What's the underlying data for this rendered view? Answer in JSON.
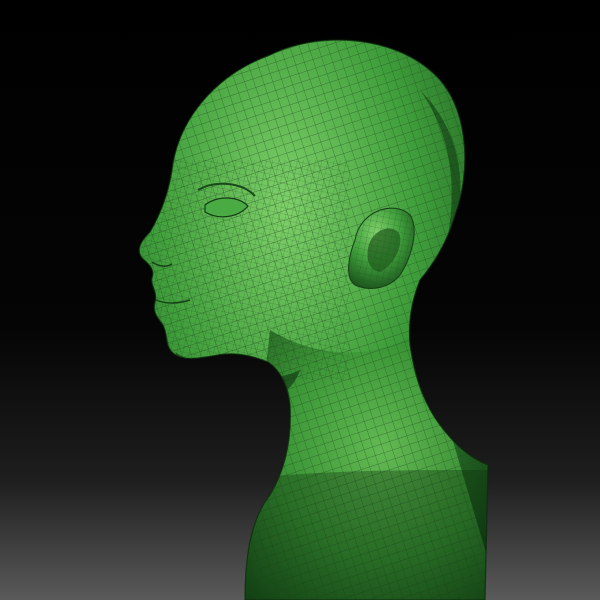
{
  "scene": {
    "subject": "head-bust-wireframe-render",
    "colors": {
      "background_top": "#000000",
      "background_bottom": "#5a5a5a",
      "mesh_base": "#3f9e3b",
      "mesh_highlight": "#7fd06a",
      "mesh_shadow": "#0f3a12",
      "wire_lines": "#1d4a1c"
    }
  }
}
